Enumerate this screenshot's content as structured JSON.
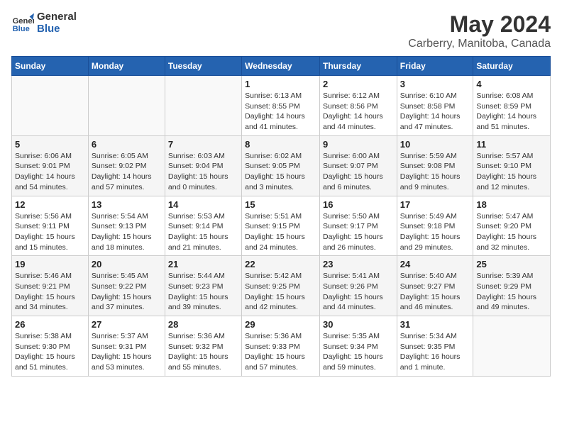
{
  "header": {
    "logo_line1": "General",
    "logo_line2": "Blue",
    "month": "May 2024",
    "location": "Carberry, Manitoba, Canada"
  },
  "weekdays": [
    "Sunday",
    "Monday",
    "Tuesday",
    "Wednesday",
    "Thursday",
    "Friday",
    "Saturday"
  ],
  "weeks": [
    [
      {
        "day": "",
        "sunrise": "",
        "sunset": "",
        "daylight": ""
      },
      {
        "day": "",
        "sunrise": "",
        "sunset": "",
        "daylight": ""
      },
      {
        "day": "",
        "sunrise": "",
        "sunset": "",
        "daylight": ""
      },
      {
        "day": "1",
        "sunrise": "Sunrise: 6:13 AM",
        "sunset": "Sunset: 8:55 PM",
        "daylight": "Daylight: 14 hours and 41 minutes."
      },
      {
        "day": "2",
        "sunrise": "Sunrise: 6:12 AM",
        "sunset": "Sunset: 8:56 PM",
        "daylight": "Daylight: 14 hours and 44 minutes."
      },
      {
        "day": "3",
        "sunrise": "Sunrise: 6:10 AM",
        "sunset": "Sunset: 8:58 PM",
        "daylight": "Daylight: 14 hours and 47 minutes."
      },
      {
        "day": "4",
        "sunrise": "Sunrise: 6:08 AM",
        "sunset": "Sunset: 8:59 PM",
        "daylight": "Daylight: 14 hours and 51 minutes."
      }
    ],
    [
      {
        "day": "5",
        "sunrise": "Sunrise: 6:06 AM",
        "sunset": "Sunset: 9:01 PM",
        "daylight": "Daylight: 14 hours and 54 minutes."
      },
      {
        "day": "6",
        "sunrise": "Sunrise: 6:05 AM",
        "sunset": "Sunset: 9:02 PM",
        "daylight": "Daylight: 14 hours and 57 minutes."
      },
      {
        "day": "7",
        "sunrise": "Sunrise: 6:03 AM",
        "sunset": "Sunset: 9:04 PM",
        "daylight": "Daylight: 15 hours and 0 minutes."
      },
      {
        "day": "8",
        "sunrise": "Sunrise: 6:02 AM",
        "sunset": "Sunset: 9:05 PM",
        "daylight": "Daylight: 15 hours and 3 minutes."
      },
      {
        "day": "9",
        "sunrise": "Sunrise: 6:00 AM",
        "sunset": "Sunset: 9:07 PM",
        "daylight": "Daylight: 15 hours and 6 minutes."
      },
      {
        "day": "10",
        "sunrise": "Sunrise: 5:59 AM",
        "sunset": "Sunset: 9:08 PM",
        "daylight": "Daylight: 15 hours and 9 minutes."
      },
      {
        "day": "11",
        "sunrise": "Sunrise: 5:57 AM",
        "sunset": "Sunset: 9:10 PM",
        "daylight": "Daylight: 15 hours and 12 minutes."
      }
    ],
    [
      {
        "day": "12",
        "sunrise": "Sunrise: 5:56 AM",
        "sunset": "Sunset: 9:11 PM",
        "daylight": "Daylight: 15 hours and 15 minutes."
      },
      {
        "day": "13",
        "sunrise": "Sunrise: 5:54 AM",
        "sunset": "Sunset: 9:13 PM",
        "daylight": "Daylight: 15 hours and 18 minutes."
      },
      {
        "day": "14",
        "sunrise": "Sunrise: 5:53 AM",
        "sunset": "Sunset: 9:14 PM",
        "daylight": "Daylight: 15 hours and 21 minutes."
      },
      {
        "day": "15",
        "sunrise": "Sunrise: 5:51 AM",
        "sunset": "Sunset: 9:15 PM",
        "daylight": "Daylight: 15 hours and 24 minutes."
      },
      {
        "day": "16",
        "sunrise": "Sunrise: 5:50 AM",
        "sunset": "Sunset: 9:17 PM",
        "daylight": "Daylight: 15 hours and 26 minutes."
      },
      {
        "day": "17",
        "sunrise": "Sunrise: 5:49 AM",
        "sunset": "Sunset: 9:18 PM",
        "daylight": "Daylight: 15 hours and 29 minutes."
      },
      {
        "day": "18",
        "sunrise": "Sunrise: 5:47 AM",
        "sunset": "Sunset: 9:20 PM",
        "daylight": "Daylight: 15 hours and 32 minutes."
      }
    ],
    [
      {
        "day": "19",
        "sunrise": "Sunrise: 5:46 AM",
        "sunset": "Sunset: 9:21 PM",
        "daylight": "Daylight: 15 hours and 34 minutes."
      },
      {
        "day": "20",
        "sunrise": "Sunrise: 5:45 AM",
        "sunset": "Sunset: 9:22 PM",
        "daylight": "Daylight: 15 hours and 37 minutes."
      },
      {
        "day": "21",
        "sunrise": "Sunrise: 5:44 AM",
        "sunset": "Sunset: 9:23 PM",
        "daylight": "Daylight: 15 hours and 39 minutes."
      },
      {
        "day": "22",
        "sunrise": "Sunrise: 5:42 AM",
        "sunset": "Sunset: 9:25 PM",
        "daylight": "Daylight: 15 hours and 42 minutes."
      },
      {
        "day": "23",
        "sunrise": "Sunrise: 5:41 AM",
        "sunset": "Sunset: 9:26 PM",
        "daylight": "Daylight: 15 hours and 44 minutes."
      },
      {
        "day": "24",
        "sunrise": "Sunrise: 5:40 AM",
        "sunset": "Sunset: 9:27 PM",
        "daylight": "Daylight: 15 hours and 46 minutes."
      },
      {
        "day": "25",
        "sunrise": "Sunrise: 5:39 AM",
        "sunset": "Sunset: 9:29 PM",
        "daylight": "Daylight: 15 hours and 49 minutes."
      }
    ],
    [
      {
        "day": "26",
        "sunrise": "Sunrise: 5:38 AM",
        "sunset": "Sunset: 9:30 PM",
        "daylight": "Daylight: 15 hours and 51 minutes."
      },
      {
        "day": "27",
        "sunrise": "Sunrise: 5:37 AM",
        "sunset": "Sunset: 9:31 PM",
        "daylight": "Daylight: 15 hours and 53 minutes."
      },
      {
        "day": "28",
        "sunrise": "Sunrise: 5:36 AM",
        "sunset": "Sunset: 9:32 PM",
        "daylight": "Daylight: 15 hours and 55 minutes."
      },
      {
        "day": "29",
        "sunrise": "Sunrise: 5:36 AM",
        "sunset": "Sunset: 9:33 PM",
        "daylight": "Daylight: 15 hours and 57 minutes."
      },
      {
        "day": "30",
        "sunrise": "Sunrise: 5:35 AM",
        "sunset": "Sunset: 9:34 PM",
        "daylight": "Daylight: 15 hours and 59 minutes."
      },
      {
        "day": "31",
        "sunrise": "Sunrise: 5:34 AM",
        "sunset": "Sunset: 9:35 PM",
        "daylight": "Daylight: 16 hours and 1 minute."
      },
      {
        "day": "",
        "sunrise": "",
        "sunset": "",
        "daylight": ""
      }
    ]
  ]
}
